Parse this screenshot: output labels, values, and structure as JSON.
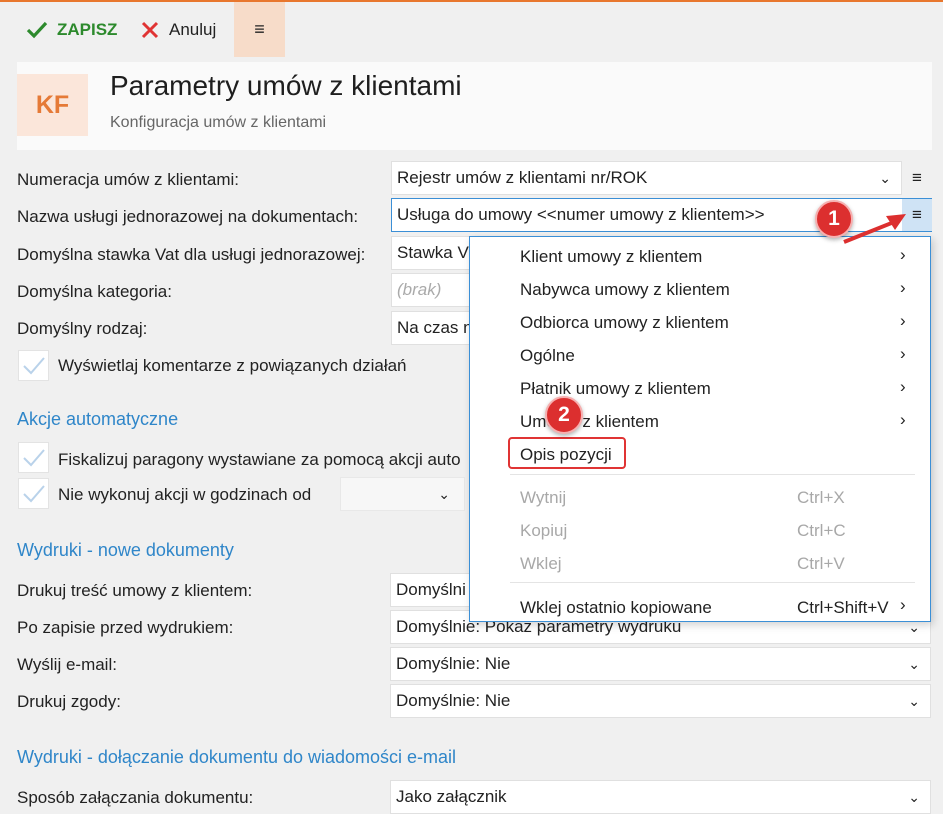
{
  "toolbar": {
    "save_label": "ZAPISZ",
    "cancel_label": "Anuluj",
    "menu_glyph": "≡"
  },
  "header": {
    "logo": "KF",
    "title": "Parametry umów z klientami",
    "subtitle": "Konfiguracja umów z klientami"
  },
  "form": {
    "numeracja": {
      "label": "Numeracja umów z klientami:",
      "value": "Rejestr umów z klientami nr/ROK"
    },
    "nazwa_uslugi": {
      "label": "Nazwa usługi jednorazowej na dokumentach:",
      "value": "Usługa do umowy <<numer umowy z klientem>>"
    },
    "stawka_vat": {
      "label": "Domyślna stawka Vat dla usługi jednorazowej:",
      "value": "Stawka V"
    },
    "kategoria": {
      "label": "Domyślna kategoria:",
      "placeholder": "(brak)"
    },
    "rodzaj": {
      "label": "Domyślny rodzaj:",
      "value": "Na czas n"
    },
    "komentarze": {
      "label": "Wyświetlaj komentarze z powiązanych działań",
      "checked": true
    }
  },
  "akcje": {
    "title": "Akcje automatyczne",
    "fiskalizuj": {
      "label": "Fiskalizuj paragony wystawiane za pomocą akcji auto",
      "checked": true
    },
    "nie_wykonuj": {
      "label": "Nie wykonuj akcji w godzinach od",
      "checked": true
    }
  },
  "wydruki_nowe": {
    "title": "Wydruki - nowe dokumenty",
    "tresc": {
      "label": "Drukuj treść umowy z klientem:",
      "value": "Domyślni"
    },
    "po_zapisie": {
      "label": "Po zapisie przed wydrukiem:",
      "value": "Domyślnie: Pokaż parametry wydruku"
    },
    "email": {
      "label": "Wyślij e-mail:",
      "value": "Domyślnie: Nie"
    },
    "zgody": {
      "label": "Drukuj zgody:",
      "value": "Domyślnie: Nie"
    }
  },
  "wydruki_email": {
    "title": "Wydruki - dołączanie dokumentu do wiadomości e-mail",
    "sposob": {
      "label": "Sposób załączania dokumentu:",
      "value": "Jako załącznik"
    }
  },
  "context_menu": {
    "items": [
      {
        "label": "Klient umowy z klientem",
        "submenu": "›"
      },
      {
        "label": "Nabywca umowy z klientem",
        "submenu": "›"
      },
      {
        "label": "Odbiorca umowy z klientem",
        "submenu": "›"
      },
      {
        "label": "Ogólne",
        "submenu": "›"
      },
      {
        "label": "Płatnik umowy z klientem",
        "submenu": "›"
      },
      {
        "label": "Umowa z klientem",
        "submenu": "›"
      },
      {
        "label": "Opis pozycji"
      }
    ],
    "edit_items": [
      {
        "label": "Wytnij",
        "shortcut": "Ctrl+X"
      },
      {
        "label": "Kopiuj",
        "shortcut": "Ctrl+C"
      },
      {
        "label": "Wklej",
        "shortcut": "Ctrl+V"
      }
    ],
    "paste_last": {
      "label": "Wklej ostatnio kopiowane",
      "shortcut": "Ctrl+Shift+V",
      "submenu": "›"
    }
  },
  "annotations": {
    "step1": "1",
    "step2": "2"
  },
  "colors": {
    "accent": "#e8772e",
    "section": "#2f86c9",
    "save": "#2d8a2d",
    "cancel": "#e03434",
    "focus": "#3b8fd6",
    "annotation": "#dc2f2f"
  },
  "glyphs": {
    "chevron": "⌄",
    "hamburger": "≡"
  }
}
